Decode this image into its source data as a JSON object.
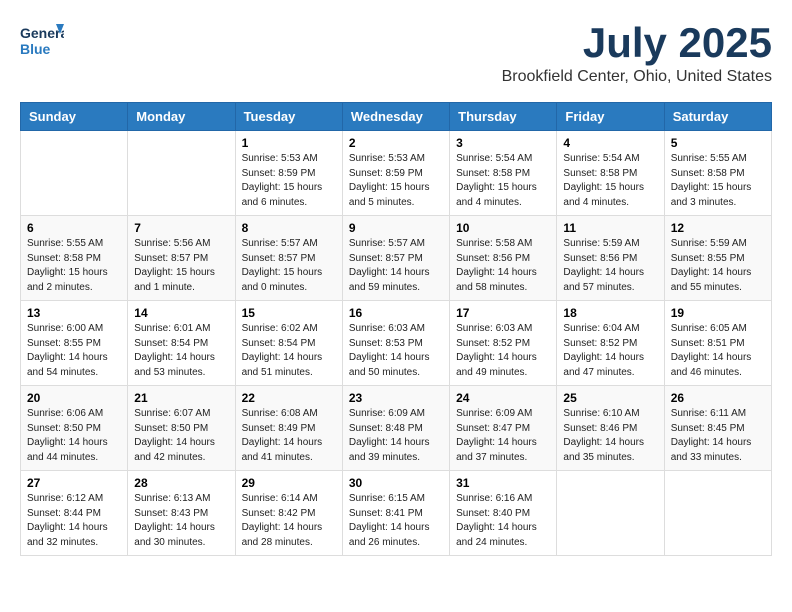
{
  "header": {
    "logo_line1": "General",
    "logo_line2": "Blue",
    "month": "July 2025",
    "location": "Brookfield Center, Ohio, United States"
  },
  "weekdays": [
    "Sunday",
    "Monday",
    "Tuesday",
    "Wednesday",
    "Thursday",
    "Friday",
    "Saturday"
  ],
  "weeks": [
    [
      {
        "day": "",
        "info": ""
      },
      {
        "day": "",
        "info": ""
      },
      {
        "day": "1",
        "info": "Sunrise: 5:53 AM\nSunset: 8:59 PM\nDaylight: 15 hours\nand 6 minutes."
      },
      {
        "day": "2",
        "info": "Sunrise: 5:53 AM\nSunset: 8:59 PM\nDaylight: 15 hours\nand 5 minutes."
      },
      {
        "day": "3",
        "info": "Sunrise: 5:54 AM\nSunset: 8:58 PM\nDaylight: 15 hours\nand 4 minutes."
      },
      {
        "day": "4",
        "info": "Sunrise: 5:54 AM\nSunset: 8:58 PM\nDaylight: 15 hours\nand 4 minutes."
      },
      {
        "day": "5",
        "info": "Sunrise: 5:55 AM\nSunset: 8:58 PM\nDaylight: 15 hours\nand 3 minutes."
      }
    ],
    [
      {
        "day": "6",
        "info": "Sunrise: 5:55 AM\nSunset: 8:58 PM\nDaylight: 15 hours\nand 2 minutes."
      },
      {
        "day": "7",
        "info": "Sunrise: 5:56 AM\nSunset: 8:57 PM\nDaylight: 15 hours\nand 1 minute."
      },
      {
        "day": "8",
        "info": "Sunrise: 5:57 AM\nSunset: 8:57 PM\nDaylight: 15 hours\nand 0 minutes."
      },
      {
        "day": "9",
        "info": "Sunrise: 5:57 AM\nSunset: 8:57 PM\nDaylight: 14 hours\nand 59 minutes."
      },
      {
        "day": "10",
        "info": "Sunrise: 5:58 AM\nSunset: 8:56 PM\nDaylight: 14 hours\nand 58 minutes."
      },
      {
        "day": "11",
        "info": "Sunrise: 5:59 AM\nSunset: 8:56 PM\nDaylight: 14 hours\nand 57 minutes."
      },
      {
        "day": "12",
        "info": "Sunrise: 5:59 AM\nSunset: 8:55 PM\nDaylight: 14 hours\nand 55 minutes."
      }
    ],
    [
      {
        "day": "13",
        "info": "Sunrise: 6:00 AM\nSunset: 8:55 PM\nDaylight: 14 hours\nand 54 minutes."
      },
      {
        "day": "14",
        "info": "Sunrise: 6:01 AM\nSunset: 8:54 PM\nDaylight: 14 hours\nand 53 minutes."
      },
      {
        "day": "15",
        "info": "Sunrise: 6:02 AM\nSunset: 8:54 PM\nDaylight: 14 hours\nand 51 minutes."
      },
      {
        "day": "16",
        "info": "Sunrise: 6:03 AM\nSunset: 8:53 PM\nDaylight: 14 hours\nand 50 minutes."
      },
      {
        "day": "17",
        "info": "Sunrise: 6:03 AM\nSunset: 8:52 PM\nDaylight: 14 hours\nand 49 minutes."
      },
      {
        "day": "18",
        "info": "Sunrise: 6:04 AM\nSunset: 8:52 PM\nDaylight: 14 hours\nand 47 minutes."
      },
      {
        "day": "19",
        "info": "Sunrise: 6:05 AM\nSunset: 8:51 PM\nDaylight: 14 hours\nand 46 minutes."
      }
    ],
    [
      {
        "day": "20",
        "info": "Sunrise: 6:06 AM\nSunset: 8:50 PM\nDaylight: 14 hours\nand 44 minutes."
      },
      {
        "day": "21",
        "info": "Sunrise: 6:07 AM\nSunset: 8:50 PM\nDaylight: 14 hours\nand 42 minutes."
      },
      {
        "day": "22",
        "info": "Sunrise: 6:08 AM\nSunset: 8:49 PM\nDaylight: 14 hours\nand 41 minutes."
      },
      {
        "day": "23",
        "info": "Sunrise: 6:09 AM\nSunset: 8:48 PM\nDaylight: 14 hours\nand 39 minutes."
      },
      {
        "day": "24",
        "info": "Sunrise: 6:09 AM\nSunset: 8:47 PM\nDaylight: 14 hours\nand 37 minutes."
      },
      {
        "day": "25",
        "info": "Sunrise: 6:10 AM\nSunset: 8:46 PM\nDaylight: 14 hours\nand 35 minutes."
      },
      {
        "day": "26",
        "info": "Sunrise: 6:11 AM\nSunset: 8:45 PM\nDaylight: 14 hours\nand 33 minutes."
      }
    ],
    [
      {
        "day": "27",
        "info": "Sunrise: 6:12 AM\nSunset: 8:44 PM\nDaylight: 14 hours\nand 32 minutes."
      },
      {
        "day": "28",
        "info": "Sunrise: 6:13 AM\nSunset: 8:43 PM\nDaylight: 14 hours\nand 30 minutes."
      },
      {
        "day": "29",
        "info": "Sunrise: 6:14 AM\nSunset: 8:42 PM\nDaylight: 14 hours\nand 28 minutes."
      },
      {
        "day": "30",
        "info": "Sunrise: 6:15 AM\nSunset: 8:41 PM\nDaylight: 14 hours\nand 26 minutes."
      },
      {
        "day": "31",
        "info": "Sunrise: 6:16 AM\nSunset: 8:40 PM\nDaylight: 14 hours\nand 24 minutes."
      },
      {
        "day": "",
        "info": ""
      },
      {
        "day": "",
        "info": ""
      }
    ]
  ]
}
